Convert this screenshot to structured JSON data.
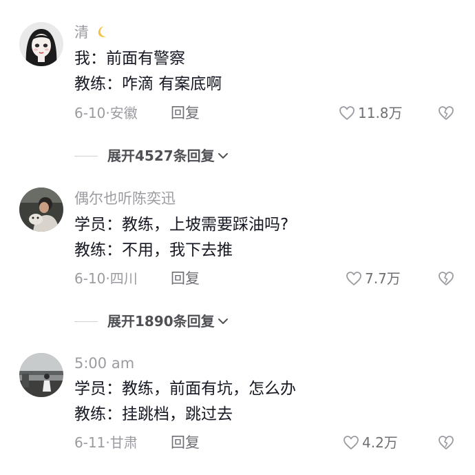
{
  "comments": [
    {
      "username": "清",
      "lines": [
        "我：前面有警察",
        "教练：咋滴 有案底啊"
      ],
      "date": "6-10",
      "location": "安徽",
      "reply_label": "回复",
      "likes": "11.8万",
      "expand_label": "展开4527条回复"
    },
    {
      "username": "偶尔也听陈奕迅",
      "lines": [
        "学员：教练，上坡需要踩油吗?",
        "教练：不用，我下去推"
      ],
      "date": "6-10",
      "location": "四川",
      "reply_label": "回复",
      "likes": "7.7万",
      "expand_label": "展开1890条回复"
    },
    {
      "username": "5:00 am",
      "lines": [
        "学员：教练，前面有坑，怎么办",
        "教练：挂跳档，跳过去"
      ],
      "date": "6-11",
      "location": "甘肃",
      "reply_label": "回复",
      "likes": "4.2万"
    }
  ],
  "separator": "·",
  "icons": {
    "like": "heart-outline-icon",
    "dislike": "broken-heart-icon",
    "expand": "chevron-down-icon",
    "moon": "crescent-moon-icon"
  },
  "colors": {
    "text": "#161823",
    "secondary": "#9a9ba1",
    "action": "#6e6f75"
  }
}
